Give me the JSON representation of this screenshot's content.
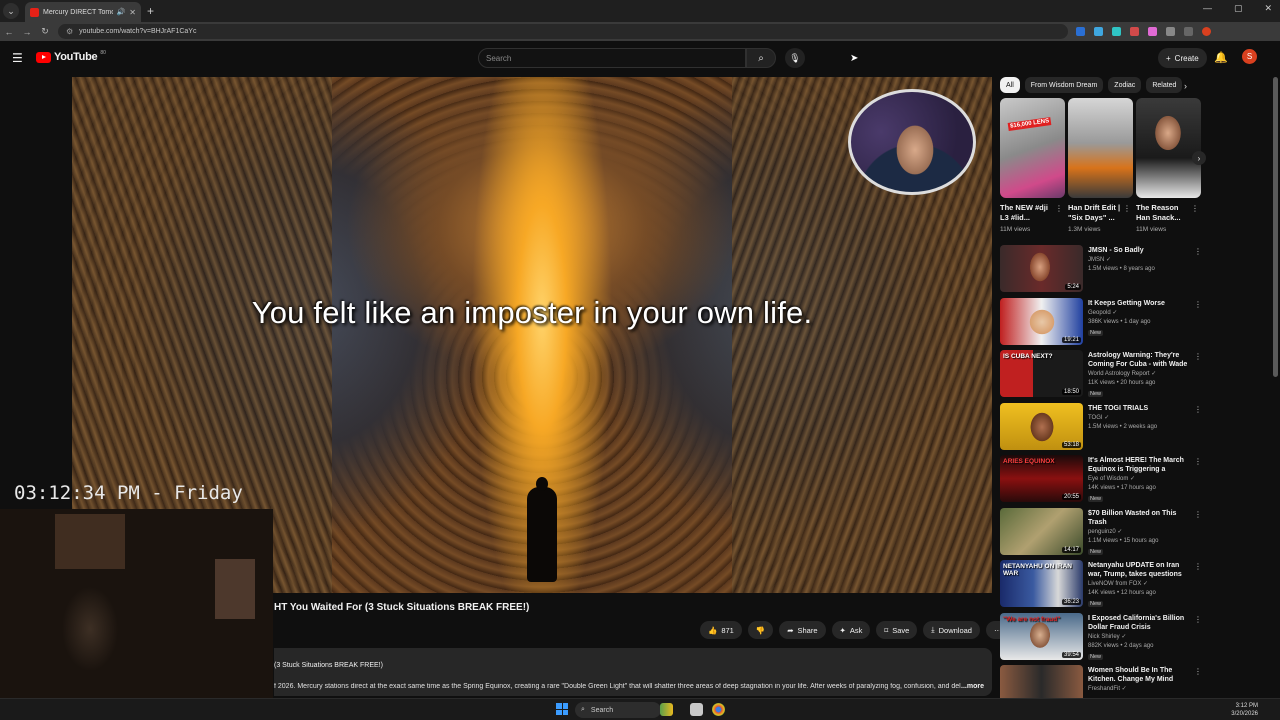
{
  "browser": {
    "tab_title": "Mercury DIRECT Tomorrow",
    "url": "youtube.com/watch?v=BHJrAF1CaYc"
  },
  "youtube": {
    "logo_text": "YouTube",
    "logo_sup": "80",
    "search_placeholder": "Search",
    "create_label": "Create",
    "avatar_letter": "S"
  },
  "player": {
    "subtitle": "You felt like an imposter in your own life."
  },
  "overlay": {
    "clock": "03:12:34 PM - Friday"
  },
  "video": {
    "title": "HT You Waited For (3 Stuck Situations BREAK FREE!)",
    "like_count": "871",
    "share_label": "Share",
    "ask_label": "Ask",
    "save_label": "Save",
    "download_label": "Download",
    "description_heading": "(3 Stuck Situations BREAK FREE!)",
    "description_text": "f 2026. Mercury stations direct at the exact same time as the Spring Equinox, creating a rare \"Double Green Light\" that will shatter three areas of deep stagnation in your life. After weeks of paralyzing fog, confusion, and del",
    "more_label": "...more"
  },
  "chips": [
    "All",
    "From Wisdom Dream",
    "Zodiac",
    "Related"
  ],
  "shorts": [
    {
      "title": "The NEW #dji L3 #lid...",
      "views": "11M views",
      "badge": "$16,000 LENS"
    },
    {
      "title": "Han Drift Edit | \"Six Days\" ...",
      "views": "1.3M views"
    },
    {
      "title": "The Reason Han Snack...",
      "views": "11M views"
    }
  ],
  "recommendations": [
    {
      "title": "JMSN - So Badly",
      "channel": "JMSN",
      "meta": "1.5M views • 8 years ago",
      "duration": "5:24",
      "new": false
    },
    {
      "title": "It Keeps Getting Worse",
      "channel": "Geopold",
      "meta": "386K views • 1 day ago",
      "duration": "19:21",
      "new": true
    },
    {
      "title": "Astrology Warning: They're Coming For Cuba - with Wade ...",
      "channel": "World Astrology Report",
      "meta": "11K views • 20 hours ago",
      "duration": "18:50",
      "new": true,
      "thumb_text": "IS CUBA NEXT?"
    },
    {
      "title": "THE TOGI TRIALS",
      "channel": "TOGI",
      "meta": "1.5M views • 2 weeks ago",
      "duration": "53:18",
      "new": false
    },
    {
      "title": "It's Almost HERE! The March Equinox is Triggering a MAJO...",
      "channel": "Eye of Wisdom",
      "meta": "14K views • 17 hours ago",
      "duration": "20:55",
      "new": true,
      "thumb_text": "ARIES EQUINOX"
    },
    {
      "title": "$70 Billion Wasted on This Trash",
      "channel": "penguinz0",
      "meta": "1.1M views • 15 hours ago",
      "duration": "14:17",
      "new": true
    },
    {
      "title": "Netanyahu UPDATE on Iran war, Trump, takes questions",
      "channel": "LiveNOW from FOX",
      "meta": "14K views • 12 hours ago",
      "duration": "36:23",
      "new": true,
      "thumb_text": "NETANYAHU ON IRAN WAR"
    },
    {
      "title": "I Exposed California's Billion Dollar Fraud Crisis",
      "channel": "Nick Shirley",
      "meta": "882K views • 2 days ago",
      "duration": "39:54",
      "new": true,
      "thumb_text": "\"We are not fraud\""
    },
    {
      "title": "Women Should Be In The Kitchen. Change My Mind Stre...",
      "channel": "FreshandFit",
      "meta": "",
      "duration": "",
      "new": false
    }
  ],
  "taskbar": {
    "search_label": "Search",
    "time": "3:12 PM",
    "date": "3/20/2026"
  },
  "colors": {
    "accent": "#ff0000",
    "avatar": "#d9401f",
    "background": "#0f0f0f"
  }
}
